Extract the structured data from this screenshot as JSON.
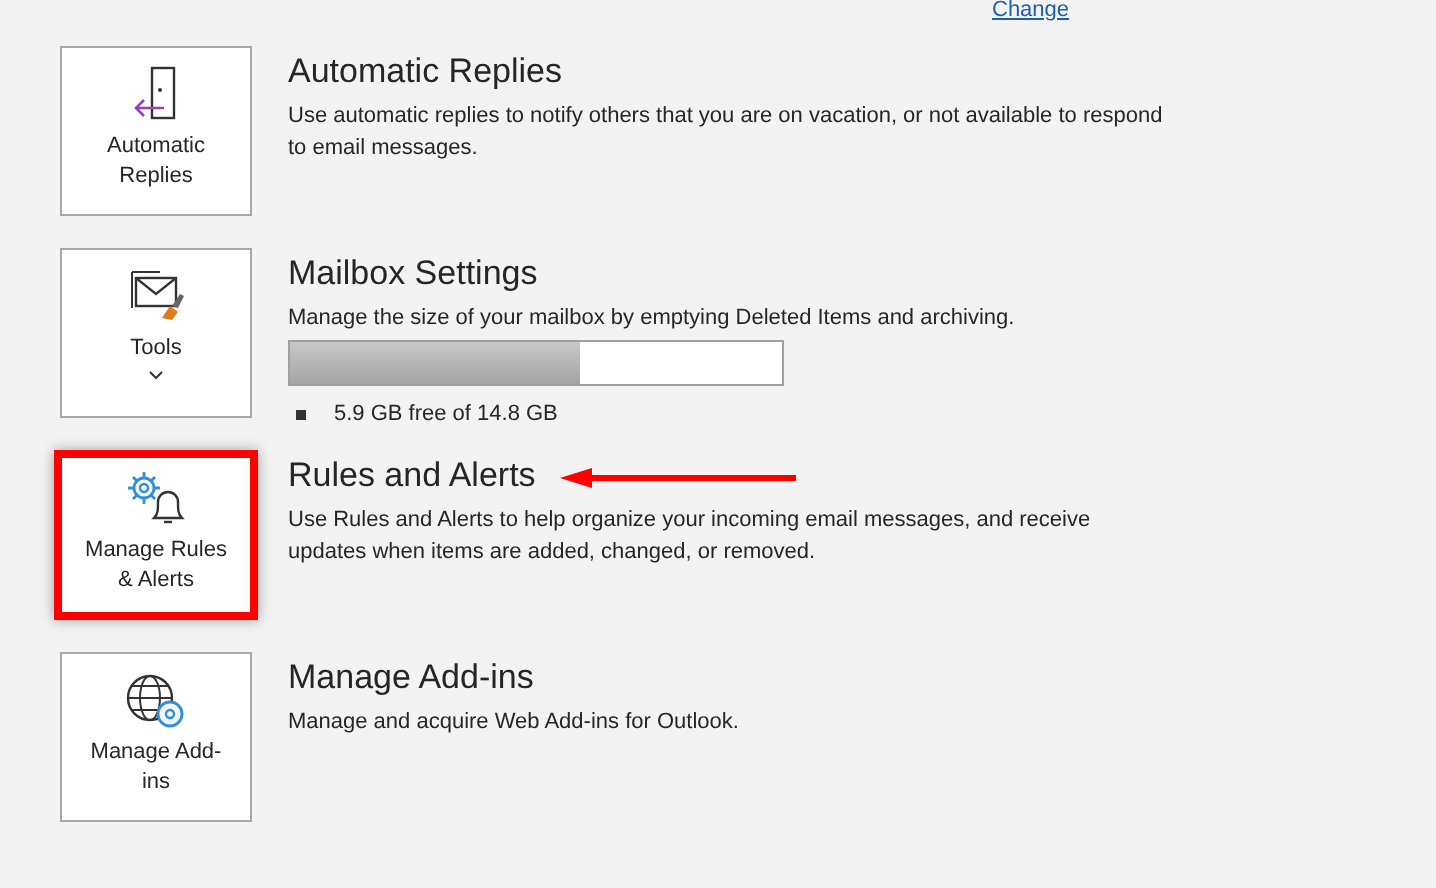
{
  "top_link": "Change",
  "sections": [
    {
      "button_label": "Automatic Replies",
      "has_dropdown": false,
      "highlighted": false,
      "arrow": false,
      "title": "Automatic Replies",
      "description": "Use automatic replies to notify others that you are on vacation, or not available to respond to email messages."
    },
    {
      "button_label": "Tools",
      "has_dropdown": true,
      "highlighted": false,
      "arrow": false,
      "title": "Mailbox Settings",
      "description": "Manage the size of your mailbox by emptying Deleted Items and archiving.",
      "storage": {
        "level": 0.59,
        "reading": "5.9 GB free of 14.8 GB"
      }
    },
    {
      "button_label": "Manage Rules & Alerts",
      "has_dropdown": false,
      "highlighted": true,
      "arrow": true,
      "title": "Rules and Alerts",
      "description": "Use Rules and Alerts to help organize your incoming email messages, and receive updates when items are added, changed, or removed."
    },
    {
      "button_label": "Manage Add-ins",
      "has_dropdown": false,
      "highlighted": false,
      "arrow": false,
      "title": "Manage Add-ins",
      "description": "Manage and acquire Web Add-ins for Outlook."
    }
  ]
}
